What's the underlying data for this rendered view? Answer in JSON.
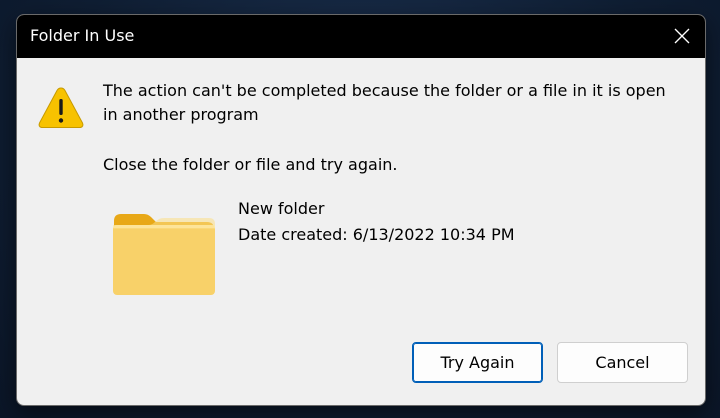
{
  "dialog": {
    "title": "Folder In Use",
    "message": "The action can't be completed because the folder or a file in it is open in another program",
    "hint": "Close the folder or file and try again.",
    "item": {
      "name": "New folder",
      "date_created": "Date created: 6/13/2022 10:34 PM"
    },
    "buttons": {
      "try_again": "Try Again",
      "cancel": "Cancel"
    }
  },
  "icons": {
    "close": "close-icon",
    "warning": "warning-icon",
    "folder": "folder-icon"
  },
  "colors": {
    "titlebar": "#000000",
    "dialog_bg": "#f0f0f0",
    "accent": "#005fb8",
    "warning": "#f7c200",
    "folder": "#f8d169"
  }
}
